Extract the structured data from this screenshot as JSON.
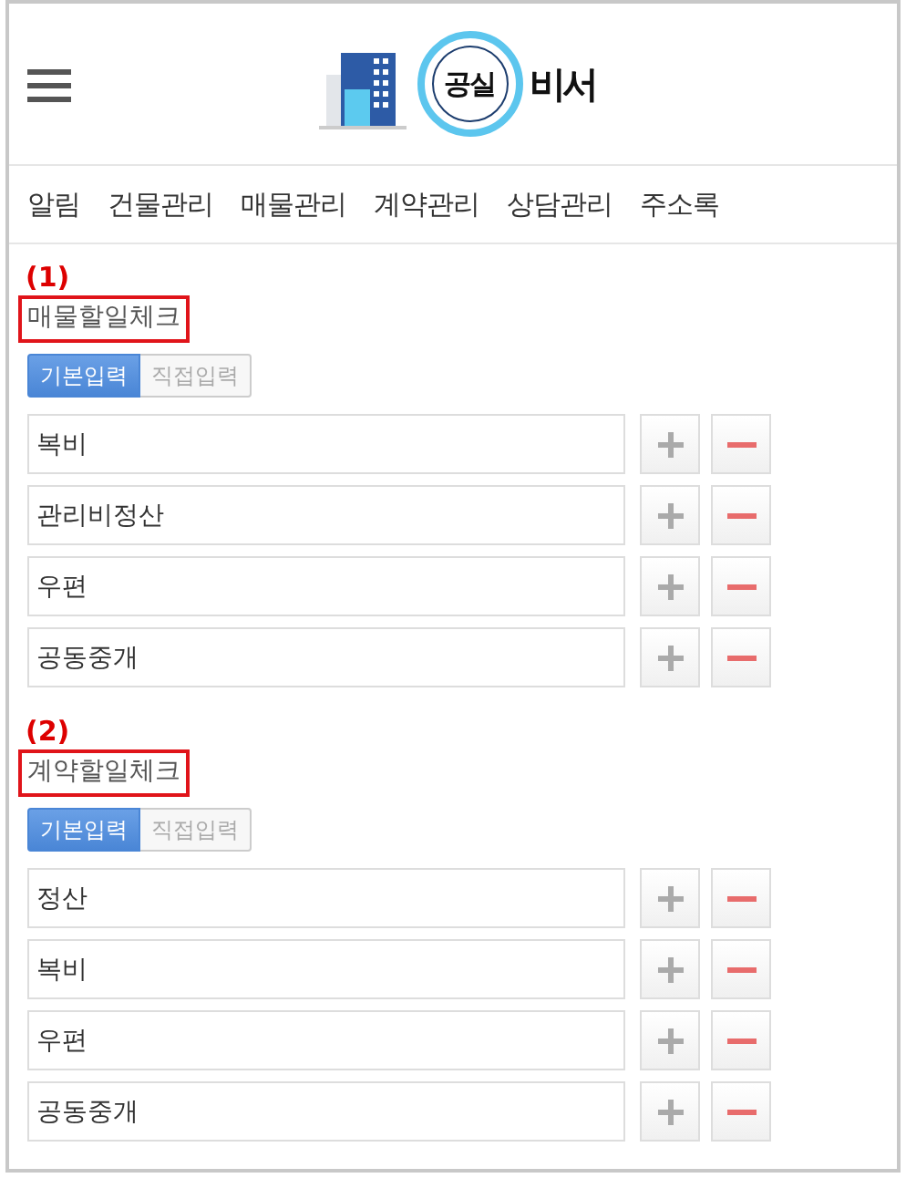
{
  "header": {
    "logo": {
      "badge": "공실",
      "name": "비서"
    }
  },
  "nav": [
    "알림",
    "건물관리",
    "매물관리",
    "계약관리",
    "상담관리",
    "주소록"
  ],
  "sections": [
    {
      "number": "(1)",
      "title": "매물할일체크",
      "modes": [
        {
          "label": "기본입력",
          "selected": true
        },
        {
          "label": "직접입력",
          "selected": false
        }
      ],
      "items": [
        {
          "value": "복비"
        },
        {
          "value": "관리비정산"
        },
        {
          "value": "우편"
        },
        {
          "value": "공동중개"
        }
      ]
    },
    {
      "number": "(2)",
      "title": "계약할일체크",
      "modes": [
        {
          "label": "기본입력",
          "selected": true
        },
        {
          "label": "직접입력",
          "selected": false
        }
      ],
      "items": [
        {
          "value": "정산"
        },
        {
          "value": "복비"
        },
        {
          "value": "우편"
        },
        {
          "value": "공동중개"
        }
      ]
    }
  ]
}
